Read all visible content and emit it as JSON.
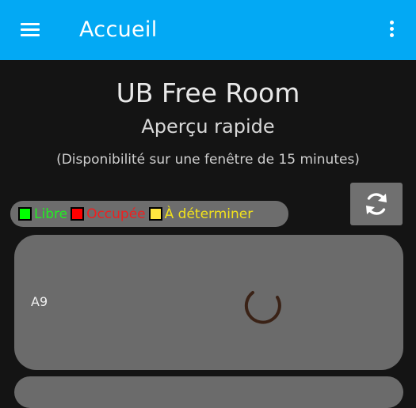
{
  "appbar": {
    "title": "Accueil",
    "menu_icon": "hamburger-menu-icon",
    "overflow_icon": "more-vertical-icon",
    "color": "#03a9f4"
  },
  "header": {
    "title": "UB Free Room",
    "subtitle": "Aperçu rapide",
    "note": "(Disponibilité sur une fenêtre de 15 minutes)"
  },
  "legend": {
    "items": [
      {
        "label": "Libre",
        "color": "#00ff00",
        "text_color": "#22ee22"
      },
      {
        "label": "Occupée",
        "color": "#ff0000",
        "text_color": "#ee2020"
      },
      {
        "label": "À déterminer",
        "color": "#ffe640",
        "text_color": "#f2e21c"
      }
    ]
  },
  "refresh_button": {
    "icon": "refresh-icon"
  },
  "rooms": [
    {
      "name": "A9",
      "status": "loading"
    }
  ]
}
